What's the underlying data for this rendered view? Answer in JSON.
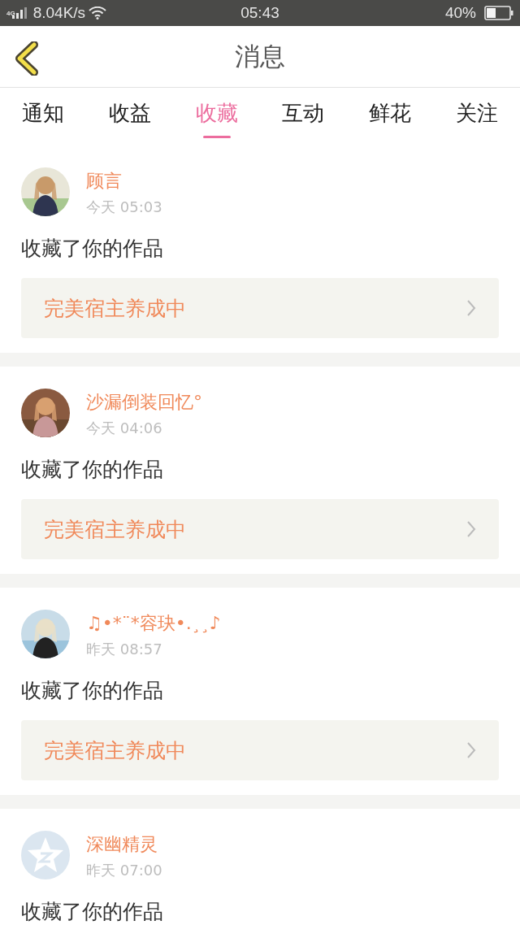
{
  "status_bar": {
    "network": "4G",
    "speed": "8.04K/s",
    "time": "05:43",
    "battery": "40%"
  },
  "header": {
    "title": "消息"
  },
  "tabs": [
    {
      "label": "通知",
      "selected": false
    },
    {
      "label": "收益",
      "selected": false
    },
    {
      "label": "收藏",
      "selected": true
    },
    {
      "label": "互动",
      "selected": false
    },
    {
      "label": "鲜花",
      "selected": false
    },
    {
      "label": "关注",
      "selected": false
    }
  ],
  "messages": [
    {
      "user": "顾言",
      "time": "今天 05:03",
      "text": "收藏了你的作品",
      "work": "完美宿主养成中"
    },
    {
      "user": "沙漏倒装回忆°",
      "time": "今天 04:06",
      "text": "收藏了你的作品",
      "work": "完美宿主养成中"
    },
    {
      "user": "♫•*¨*容玦•.¸¸♪",
      "time": "昨天 08:57",
      "text": "收藏了你的作品",
      "work": "完美宿主养成中"
    },
    {
      "user": "深幽精灵",
      "time": "昨天 07:00",
      "avatar": {
        "kind": "default"
      },
      "text": "收藏了你的作品"
    }
  ]
}
